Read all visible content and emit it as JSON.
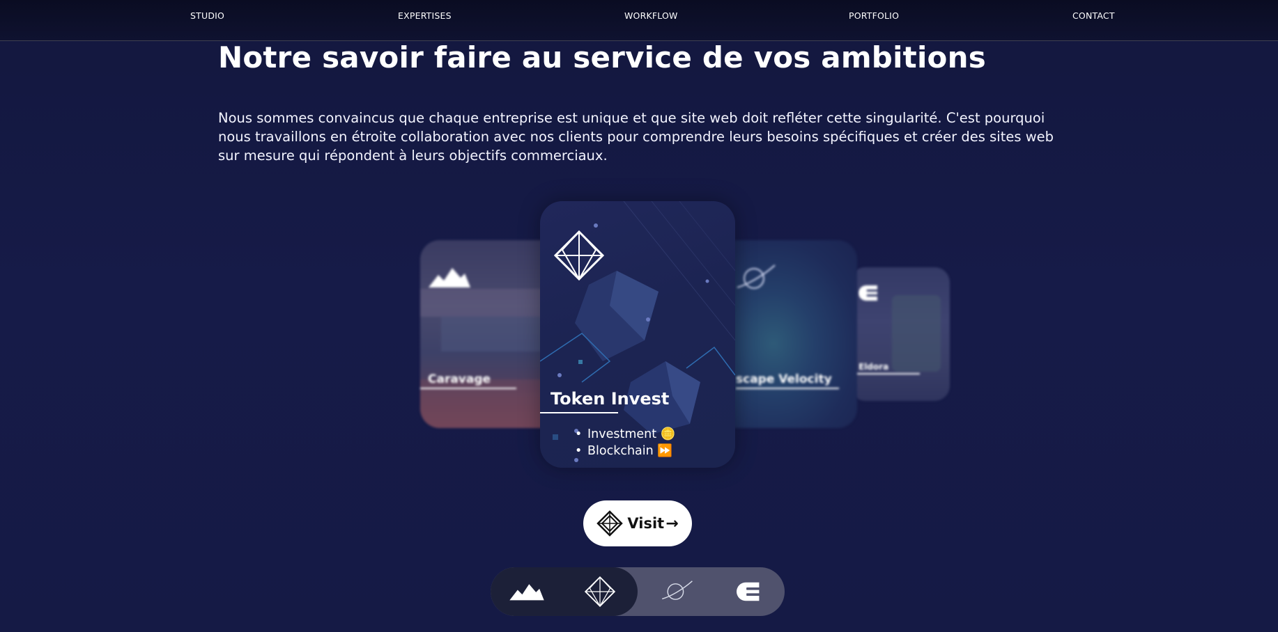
{
  "nav": {
    "items": [
      {
        "label": "STUDIO"
      },
      {
        "label": "EXPERTISES"
      },
      {
        "label": "WORKFLOW"
      },
      {
        "label": "PORTFOLIO"
      },
      {
        "label": "CONTACT"
      }
    ]
  },
  "main": {
    "heading": "Notre savoir faire au service de vos ambitions",
    "intro": "Nous sommes convaincus que chaque entreprise est unique et que site web doit refléter cette singularité. C'est pourquoi nous travaillons en étroite collaboration avec nos clients pour comprendre leurs besoins spécifiques et créer des sites web sur mesure qui répondent à leurs objectifs commerciaux."
  },
  "carousel": {
    "cards": [
      {
        "title": "Caravage",
        "icon": "mountain-icon"
      },
      {
        "title": "Token Invest",
        "icon": "diamond-icon",
        "tags": [
          "Investment 🪙",
          "Blockchain ⏩"
        ]
      },
      {
        "title": "scape Velocity",
        "icon": "planet-icon"
      },
      {
        "title": "Eldora",
        "icon": "e-logo-icon"
      }
    ],
    "active_index": 1,
    "visit_label": "Visit"
  },
  "selector": {
    "items": [
      {
        "icon": "mountain-icon"
      },
      {
        "icon": "diamond-icon"
      },
      {
        "icon": "planet-icon"
      },
      {
        "icon": "e-logo-icon"
      }
    ]
  },
  "colors": {
    "background": "#161b48",
    "navbar": "#0c0f28",
    "selector_track": "#50526d",
    "selector_active": "#1c2038"
  }
}
